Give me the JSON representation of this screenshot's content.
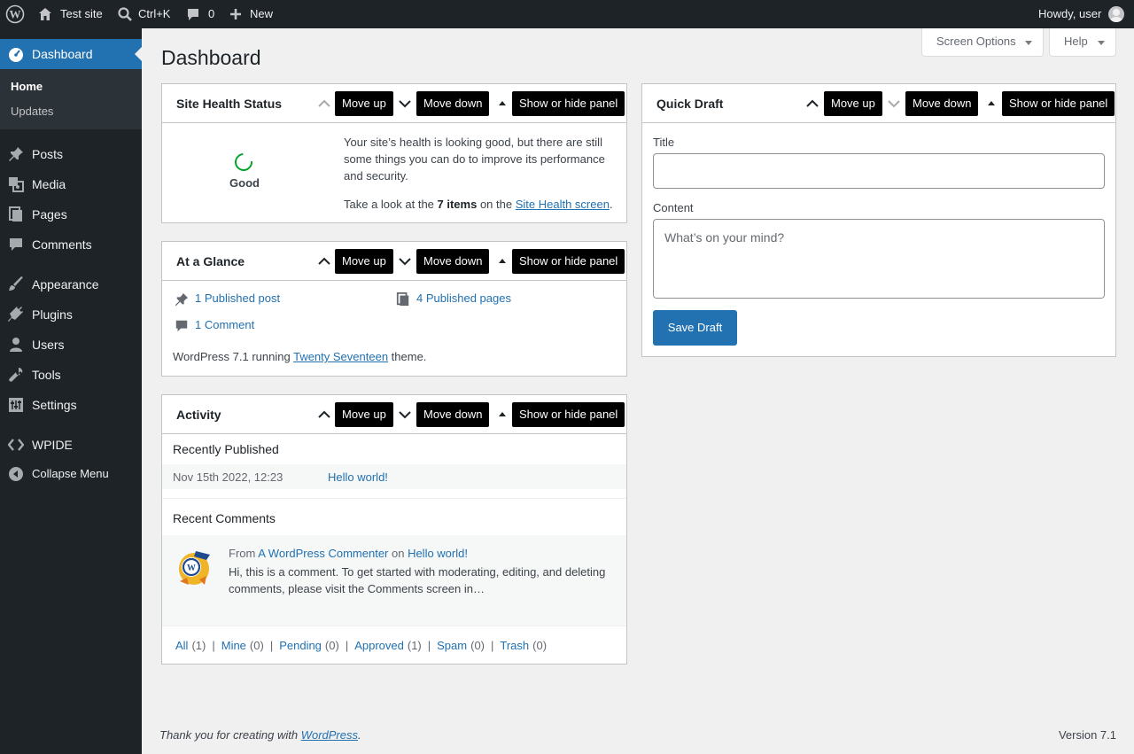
{
  "adminbar": {
    "site_name": "Test site",
    "search_shortcut": "Ctrl+K",
    "comments_count": "0",
    "new_label": "New",
    "howdy": "Howdy, user"
  },
  "sidebar": {
    "dashboard": "Dashboard",
    "home": "Home",
    "updates": "Updates",
    "items": [
      {
        "label": "Posts",
        "icon": "pin-icon"
      },
      {
        "label": "Media",
        "icon": "media-icon"
      },
      {
        "label": "Pages",
        "icon": "pages-icon"
      },
      {
        "label": "Comments",
        "icon": "comments-icon"
      },
      {
        "label": "Appearance",
        "icon": "brush-icon"
      },
      {
        "label": "Plugins",
        "icon": "plugin-icon"
      },
      {
        "label": "Users",
        "icon": "users-icon"
      },
      {
        "label": "Tools",
        "icon": "wrench-icon"
      },
      {
        "label": "Settings",
        "icon": "settings-icon"
      },
      {
        "label": "WPIDE",
        "icon": "code-icon"
      },
      {
        "label": "Collapse Menu",
        "icon": "collapse-icon"
      }
    ]
  },
  "header": {
    "screen_options": "Screen Options",
    "help": "Help",
    "title": "Dashboard"
  },
  "controls": {
    "move_up": "Move up",
    "move_down": "Move down",
    "toggle": "Show or hide panel"
  },
  "site_health": {
    "title": "Site Health Status",
    "status": "Good",
    "message": "Your site’s health is looking good, but there are still some things you can do to improve its performance and security.",
    "look_prefix": "Take a look at the ",
    "items_count": "7 items",
    "look_middle": " on the ",
    "screen_link": "Site Health screen",
    "look_suffix": "."
  },
  "glance": {
    "title": "At a Glance",
    "posts": "1 Published post",
    "pages": "4 Published pages",
    "comments": "1 Comment",
    "theme_prefix": "WordPress 7.1 running ",
    "theme_link": "Twenty Seventeen",
    "theme_suffix": " theme."
  },
  "activity": {
    "title": "Activity",
    "recently_published": "Recently Published",
    "published_date": "Nov 15th 2022, 12:23",
    "published_post": "Hello world!",
    "recent_comments": "Recent Comments",
    "comment_from": "From ",
    "comment_author": "A WordPress Commenter",
    "comment_on": " on ",
    "comment_post": "Hello world!",
    "comment_text": "Hi, this is a comment. To get started with moderating, editing, and deleting comments, please visit the Comments screen in…",
    "filters": [
      {
        "label": "All",
        "count": "(1)"
      },
      {
        "label": "Mine",
        "count": "(0)"
      },
      {
        "label": "Pending",
        "count": "(0)"
      },
      {
        "label": "Approved",
        "count": "(1)"
      },
      {
        "label": "Spam",
        "count": "(0)"
      },
      {
        "label": "Trash",
        "count": "(0)"
      }
    ]
  },
  "quick_draft": {
    "title": "Quick Draft",
    "title_label": "Title",
    "title_value": "",
    "content_label": "Content",
    "content_placeholder": "What’s on your mind?",
    "save": "Save Draft"
  },
  "footer": {
    "thanks_prefix": "Thank you for creating with ",
    "thanks_link": "WordPress",
    "thanks_suffix": ".",
    "version": "Version 7.1"
  },
  "colors": {
    "admin_dark": "#1d2327",
    "accent": "#2271b1",
    "health_good": "#00a32a"
  }
}
